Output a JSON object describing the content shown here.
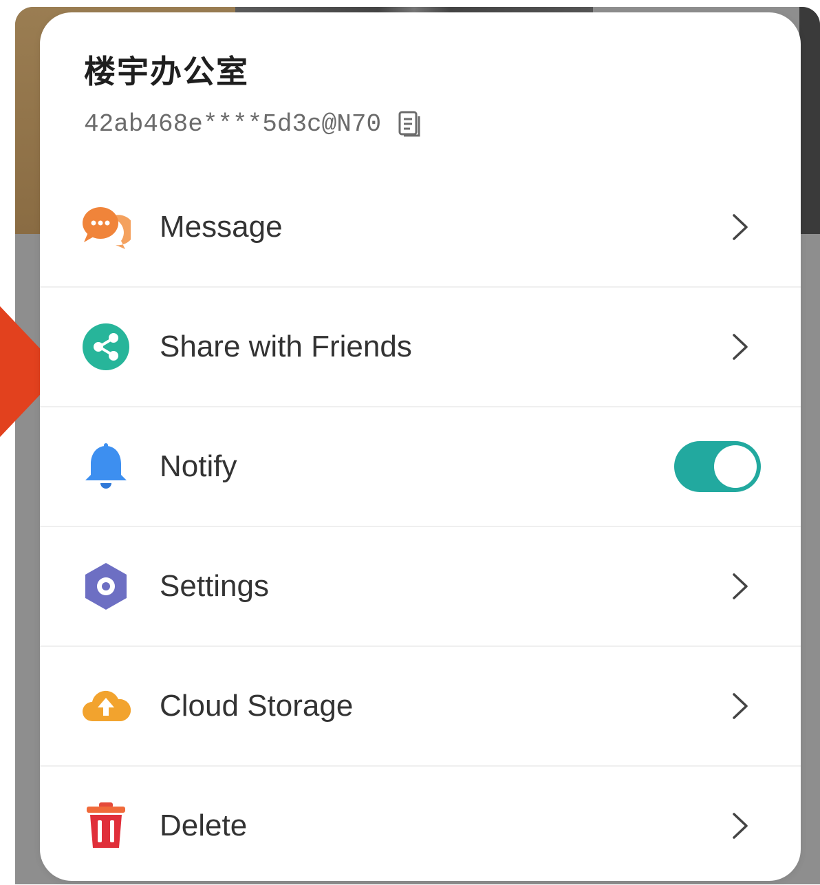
{
  "dialog": {
    "title": "楼宇办公室",
    "device_id": "42ab468e****5d3c@N70"
  },
  "menu": {
    "items": [
      {
        "label": "Message",
        "icon": "chat-bubbles-icon",
        "color": "#f08a3c"
      },
      {
        "label": "Share with Friends",
        "icon": "share-icon",
        "color": "#27b59a"
      },
      {
        "label": "Notify",
        "icon": "bell-icon",
        "color": "#3d8ff0"
      },
      {
        "label": "Settings",
        "icon": "gear-icon",
        "color": "#6d6fc3"
      },
      {
        "label": "Cloud Storage",
        "icon": "cloud-upload-icon",
        "color": "#f2a32e"
      },
      {
        "label": "Delete",
        "icon": "trash-icon",
        "color": "#e54a3a"
      }
    ]
  },
  "notify_toggle": {
    "on": true,
    "color": "#22a99f"
  },
  "colors": {
    "accent_red": "#e2411e"
  }
}
